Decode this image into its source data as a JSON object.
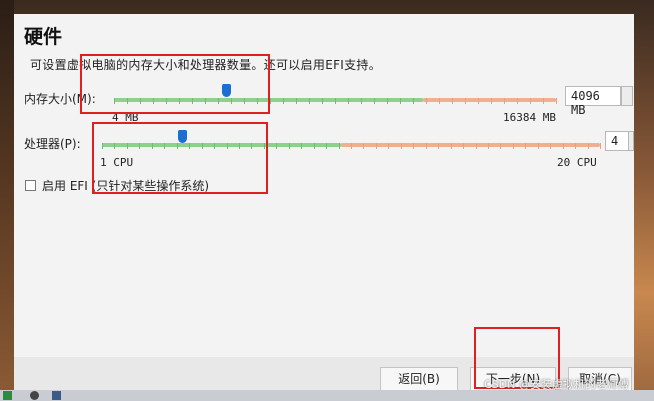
{
  "dialog": {
    "title": "硬件",
    "description": "可设置虚拟电脑的内存大小和处理器数量。还可以启用EFI支持。"
  },
  "memory": {
    "label": "内存大小(M):",
    "min_label": "4 MB",
    "max_label": "16384 MB",
    "value": "4096 MB",
    "min": 4,
    "max": 16384,
    "current": 4096,
    "colors": {
      "ok": "#8fd08f",
      "warn": "#f0b090"
    }
  },
  "processor": {
    "label": "处理器(P):",
    "min_label": "1 CPU",
    "max_label": "20 CPU",
    "value": "4",
    "min": 1,
    "max": 20,
    "current": 4,
    "colors": {
      "ok": "#8fd08f",
      "warn": "#f0b090"
    }
  },
  "efi": {
    "label": "启用 EFI (只针对某些操作系统)",
    "checked": false
  },
  "footer": {
    "back_label": "返回(B)",
    "next_label": "下一步(N)",
    "cancel_label": "取消(C)"
  },
  "watermark": "CSDN @安装虚拟机的老师傅",
  "accent_color": "#1c6fd0",
  "highlight_color": "#e02020"
}
